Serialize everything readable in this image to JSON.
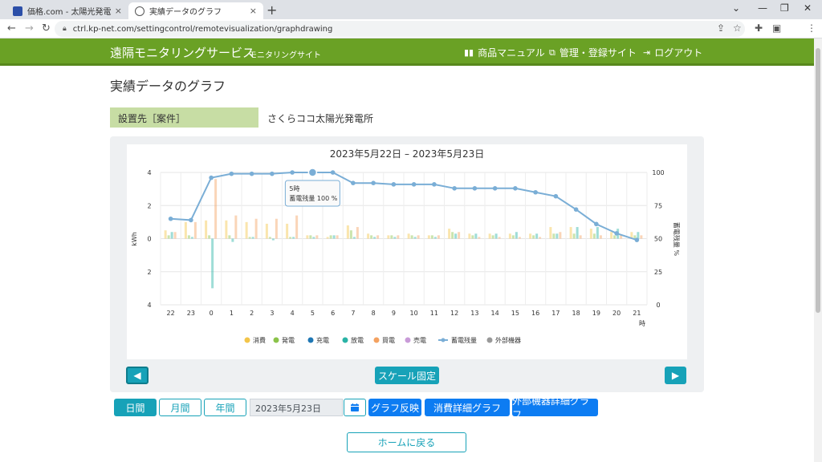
{
  "browser": {
    "tabs": [
      {
        "title": "価格.com - 太陽光発電 なんでも掲",
        "close": "×"
      },
      {
        "title": "実績データのグラフ",
        "close": "×"
      }
    ],
    "new_tab": "+",
    "url": "ctrl.kp-net.com/settingcontrol/remotevisualization/graphdrawing"
  },
  "header": {
    "brand": "遠隔モニタリングサービス",
    "brand_sub": "モニタリングサイト",
    "nav": [
      {
        "label": "商品マニュアル",
        "icon": "book-icon"
      },
      {
        "label": "管理・登録サイト",
        "icon": "external-link-icon"
      },
      {
        "label": "ログアウト",
        "icon": "logout-icon"
      }
    ]
  },
  "page": {
    "title": "実績データのグラフ",
    "setting_label": "設置先［案件］",
    "setting_value": "さくらココ太陽光発電所"
  },
  "chart_data": {
    "type": "bar",
    "title": "2023年5月22日 – 2023年5月23日",
    "xlabel": "時",
    "ylabel": "kWh",
    "y2label": "蓄電残量 %",
    "categories": [
      "22",
      "23",
      "0",
      "1",
      "2",
      "3",
      "4",
      "5",
      "6",
      "7",
      "8",
      "9",
      "10",
      "11",
      "12",
      "13",
      "14",
      "15",
      "16",
      "17",
      "18",
      "19",
      "20",
      "21"
    ],
    "y_ticks": [
      "4",
      "2",
      "0",
      "2",
      "4"
    ],
    "y2_ticks": [
      "100",
      "75",
      "50",
      "25",
      "0"
    ],
    "ylim": [
      -4,
      4
    ],
    "y2lim": [
      0,
      100
    ],
    "series": [
      {
        "name": "消費",
        "color": "#f3c54a",
        "values": [
          0.5,
          1.0,
          1.1,
          1.1,
          1.0,
          0.9,
          0.9,
          0.2,
          0.1,
          0.8,
          0.3,
          0.2,
          0.3,
          0.2,
          0.6,
          0.3,
          0.3,
          0.3,
          0.3,
          0.7,
          0.7,
          0.6,
          0.4,
          0.4
        ]
      },
      {
        "name": "発電",
        "color": "#8bc34a",
        "values": [
          0.2,
          0.2,
          0.2,
          0.2,
          0.1,
          0.1,
          0.1,
          0.2,
          0.2,
          0.5,
          0.2,
          0.2,
          0.2,
          0.2,
          0.4,
          0.2,
          0.2,
          0.2,
          0.2,
          0.3,
          0.3,
          0.3,
          0.2,
          0.2
        ]
      },
      {
        "name": "充電",
        "color": "#1f77b4",
        "values": [
          0,
          0,
          0,
          0,
          0,
          0,
          0,
          0,
          0,
          0,
          0,
          0,
          0,
          0,
          0,
          0,
          0,
          0,
          0,
          0,
          0,
          0,
          0,
          0
        ]
      },
      {
        "name": "放電",
        "color": "#2ab3a6",
        "values": [
          0.4,
          0.1,
          -3.0,
          -0.2,
          0.1,
          -0.1,
          0.1,
          0.1,
          0.2,
          0.1,
          0.1,
          0.1,
          0.1,
          0.1,
          0.3,
          0.3,
          0.3,
          0.4,
          0.3,
          0.3,
          0.7,
          0.7,
          0.6,
          0.4
        ]
      },
      {
        "name": "買電",
        "color": "#f4a261",
        "values": [
          0.4,
          1.0,
          3.6,
          1.4,
          1.2,
          1.2,
          1.4,
          0.2,
          0.2,
          0.7,
          0.2,
          0.2,
          0.2,
          0.2,
          0.4,
          0.1,
          0.1,
          0.1,
          0.1,
          0.4,
          0.2,
          0.2,
          0.2,
          0.2
        ]
      },
      {
        "name": "売電",
        "color": "#c99bd8",
        "values": [
          0,
          0,
          0,
          0,
          0,
          0,
          0,
          0,
          0,
          0,
          0,
          0,
          0,
          0,
          0,
          0,
          0,
          0,
          0,
          0,
          0,
          0,
          0,
          0
        ]
      },
      {
        "name": "外部機器",
        "color": "#999999",
        "values": [
          0,
          0,
          0,
          0,
          0,
          0,
          0,
          0,
          0,
          0,
          0,
          0,
          0,
          0,
          0,
          0,
          0,
          0,
          0,
          0,
          0,
          0,
          0,
          0
        ]
      }
    ],
    "battery": {
      "name": "蓄電残量",
      "color": "#7aaed6",
      "values": [
        65,
        64,
        96,
        99,
        99,
        99,
        100,
        100,
        100,
        92,
        92,
        91,
        91,
        91,
        88,
        88,
        88,
        88,
        85,
        82,
        72,
        61,
        54,
        49
      ]
    },
    "tooltip": {
      "title": "5時",
      "text": "蓄電残量 100 %",
      "index": 7
    },
    "legend": {
      "position": "bottom"
    },
    "grid": true
  },
  "controls": {
    "prev": "◀",
    "next": "▶",
    "scale_fixed": "スケール固定",
    "period_day": "日間",
    "period_month": "月間",
    "period_year": "年間",
    "date_value": "2023年5月23日",
    "calendar_icon": "calendar-icon",
    "graph_apply": "グラフ反映",
    "consumption_detail": "消費詳細グラフ",
    "external_detail": "外部機器詳細グラフ",
    "home": "ホームに戻る"
  }
}
